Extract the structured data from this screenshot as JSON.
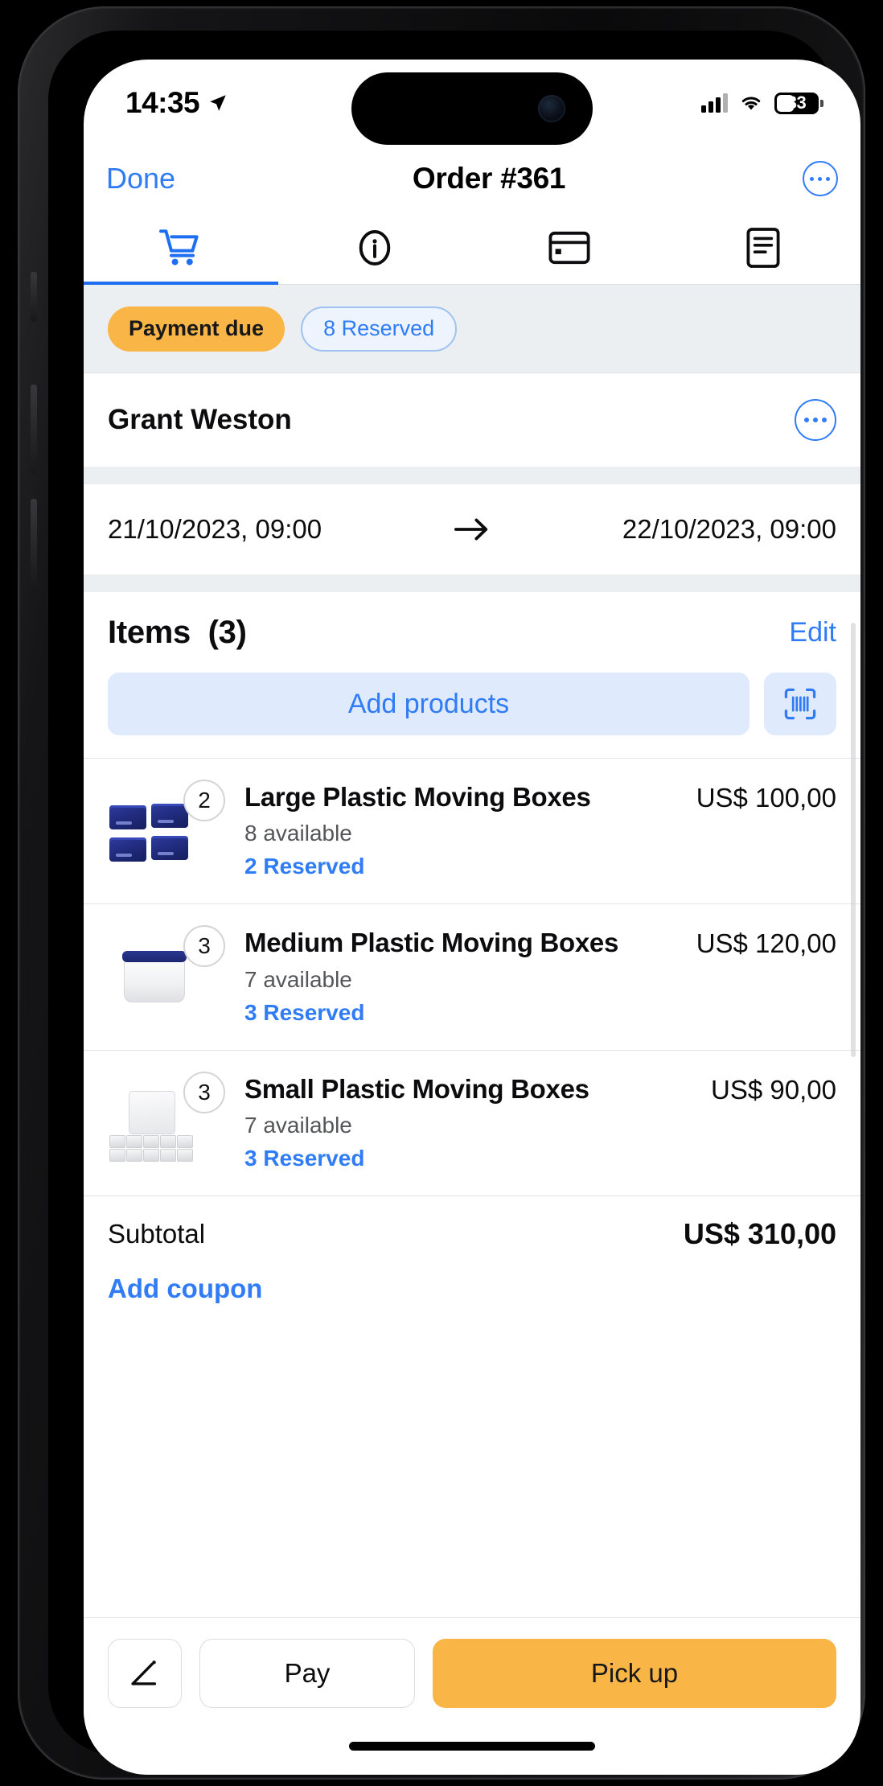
{
  "status_bar": {
    "time": "14:35",
    "location_icon": "location-arrow-icon",
    "signal_icon": "cellular-signal-icon",
    "wifi_icon": "wifi-icon",
    "battery_level": "33"
  },
  "navbar": {
    "done_label": "Done",
    "title": "Order #361",
    "more_icon": "more-options-icon"
  },
  "tabs": [
    {
      "name": "cart",
      "icon": "shopping-cart-icon",
      "active": true
    },
    {
      "name": "info",
      "icon": "info-circle-icon",
      "active": false
    },
    {
      "name": "payment",
      "icon": "credit-card-icon",
      "active": false
    },
    {
      "name": "documents",
      "icon": "document-icon",
      "active": false
    }
  ],
  "badges": [
    {
      "label": "Payment due",
      "style": "warning"
    },
    {
      "label": "8 Reserved",
      "style": "outline"
    }
  ],
  "customer": {
    "name": "Grant Weston",
    "more_icon": "more-options-icon"
  },
  "dates": {
    "start": "21/10/2023, 09:00",
    "arrow_icon": "arrow-right-icon",
    "end": "22/10/2023, 09:00"
  },
  "items_section": {
    "title": "Items",
    "count": "(3)",
    "edit_label": "Edit",
    "add_products_label": "Add products",
    "scan_icon": "barcode-scan-icon"
  },
  "products": [
    {
      "qty": "2",
      "name": "Large Plastic Moving Boxes",
      "available": "8 available",
      "reserved": "2 Reserved",
      "price": "US$ 100,00",
      "thumb": "blue-moving-boxes-image"
    },
    {
      "qty": "3",
      "name": "Medium Plastic Moving Boxes",
      "available": "7 available",
      "reserved": "3 Reserved",
      "price": "US$ 120,00",
      "thumb": "white-tote-box-image"
    },
    {
      "qty": "3",
      "name": "Small Plastic Moving Boxes",
      "available": "7 available",
      "reserved": "3 Reserved",
      "price": "US$ 90,00",
      "thumb": "small-white-boxes-image"
    }
  ],
  "totals": {
    "subtotal_label": "Subtotal",
    "subtotal_value": "US$ 310,00",
    "coupon_label": "Add coupon"
  },
  "footer": {
    "edit_icon": "signature-pen-icon",
    "pay_label": "Pay",
    "pickup_label": "Pick up"
  },
  "colors": {
    "accent_blue": "#2f7cf6",
    "warning_orange": "#f9b546",
    "badge_bg": "#eceff1"
  }
}
